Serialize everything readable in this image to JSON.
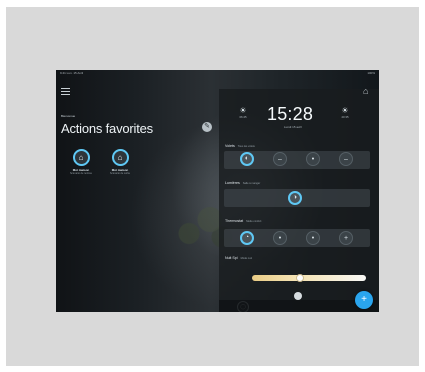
{
  "statusbar": {
    "left": "9:41 Lun. 15 Avril",
    "right": "100%"
  },
  "left": {
    "small_label": "Bienvenue",
    "title": "Actions favorites",
    "actions": [
      {
        "label": "Moi maison",
        "sub": "Scénario de rentrée"
      },
      {
        "label": "Moi maison",
        "sub": "Scénario de sortie"
      }
    ]
  },
  "clock": {
    "time": "15:28",
    "date": "Lundi 15 avril",
    "sunrise": "06:45",
    "sunset": "20:35"
  },
  "sections": {
    "volets": {
      "label": "Volets",
      "sub": "Tous les volets"
    },
    "lumieres": {
      "label": "Lumières",
      "sub": "Salle à manger"
    },
    "thermostat": {
      "label": "Thermostat",
      "sub": "Mode confort"
    },
    "nuit": {
      "label": "Nuit Spi",
      "sub": "Mode nuit"
    }
  },
  "icons": {
    "menu": "menu-icon",
    "edit": "pencil-icon",
    "home": "home-icon",
    "sunrise": "sunrise-icon",
    "sunset": "sunset-icon"
  },
  "slider": {
    "value": 0.42
  },
  "fab": {
    "label": "+"
  },
  "colors": {
    "accent": "#5fc8f4",
    "fab": "#2aa5ee",
    "slider_warm": "#e8c87b"
  }
}
